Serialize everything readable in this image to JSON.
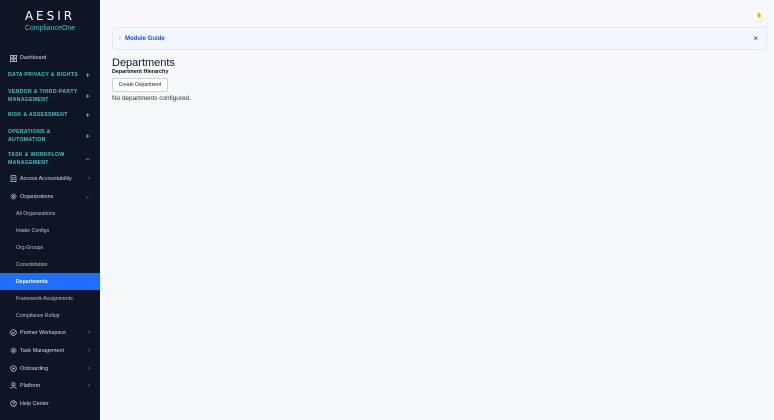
{
  "brand": {
    "name": "AESIR",
    "product": "ComplianceOne"
  },
  "sidebar": {
    "dashboard": "Dashboard",
    "sections": [
      {
        "label": "DATA PRIVACY & RIGHTS",
        "toggle": "+"
      },
      {
        "label": "VENDOR & THIRD-PARTY MANAGEMENT",
        "toggle": "+"
      },
      {
        "label": "RISK & ASSESSMENT",
        "toggle": "+"
      },
      {
        "label": "OPERATIONS & AUTOMATION",
        "toggle": "+"
      },
      {
        "label": "TASK & WORKFLOW MANAGEMENT",
        "toggle": "−"
      }
    ],
    "items": [
      {
        "label": "Access Accountability",
        "icon": "clipboard-icon"
      },
      {
        "label": "Organizations",
        "icon": "gear-icon"
      },
      {
        "label": "Partner Workspace",
        "icon": "check-circle-icon"
      },
      {
        "label": "Task Management",
        "icon": "gear-icon"
      },
      {
        "label": "Onboarding",
        "icon": "circle-icon"
      },
      {
        "label": "Platform",
        "icon": "user-icon"
      },
      {
        "label": "Help Center",
        "icon": "help-circle-icon"
      }
    ],
    "org_subitems": [
      "All Organizations",
      "Intake Configs",
      "Org Groups",
      "Consolidation",
      "Departments",
      "Framework Assignments",
      "Compliance Rollup"
    ],
    "active_subitem": "Departments"
  },
  "guide": {
    "label": "Module Guide"
  },
  "page": {
    "title": "Departments",
    "section": "Department Hierarchy",
    "create_button": "Create Department",
    "empty": "No departments configured."
  },
  "colors": {
    "sidebar_bg": "#0e1626",
    "accent": "#3ec6c0",
    "active": "#1f6fff"
  }
}
